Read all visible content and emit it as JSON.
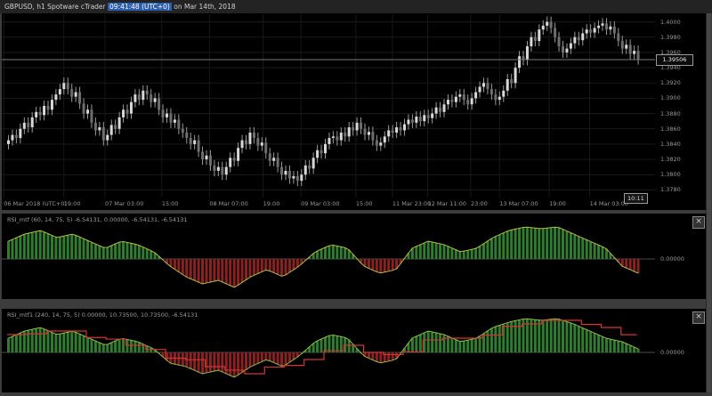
{
  "window": {
    "title_prefix": "GBPUSD, h1 Spotware cTrader ",
    "title_time": "09:41:48 (UTC+0)",
    "title_suffix": " on Mar 14th, 2018"
  },
  "main_chart": {
    "symbol": "GBPUSD",
    "timeframe": "h1",
    "current_price": 1.39506,
    "current_price_label": "1.39506",
    "time_marker": "10:11",
    "price_max": 1.401,
    "price_min": 1.377,
    "price_axis_labels": [
      "1.4000",
      "1.3980",
      "1.3960",
      "1.3940",
      "1.3920",
      "1.3900",
      "1.3880",
      "1.3860",
      "1.3840",
      "1.3820",
      "1.3800",
      "1.3780"
    ],
    "time_axis_labels": [
      {
        "label": "06 Mar 2018 (UTC+0)",
        "pos": 0.003
      },
      {
        "label": "19:00",
        "pos": 0.095
      },
      {
        "label": "07 Mar 03:00",
        "pos": 0.158
      },
      {
        "label": "15:00",
        "pos": 0.245
      },
      {
        "label": "08 Mar 07:00",
        "pos": 0.318
      },
      {
        "label": "19:00",
        "pos": 0.4
      },
      {
        "label": "09 Mar 03:00",
        "pos": 0.458
      },
      {
        "label": "15:00",
        "pos": 0.542
      },
      {
        "label": "11 Mar 23:00",
        "pos": 0.598
      },
      {
        "label": "12 Mar 11:00",
        "pos": 0.652
      },
      {
        "label": "23:00",
        "pos": 0.718
      },
      {
        "label": "13 Mar 07:00",
        "pos": 0.762
      },
      {
        "label": "19:00",
        "pos": 0.838
      },
      {
        "label": "14 Mar 03:00",
        "pos": 0.9
      }
    ],
    "first_open": 1.384,
    "candle_closes": [
      1.3845,
      1.3852,
      1.3848,
      1.386,
      1.3868,
      1.3862,
      1.3875,
      1.3882,
      1.3878,
      1.389,
      1.3885,
      1.3898,
      1.3905,
      1.3912,
      1.392,
      1.3912,
      1.3902,
      1.3908,
      1.3893,
      1.388,
      1.3885,
      1.3868,
      1.3858,
      1.3862,
      1.3845,
      1.3852,
      1.3865,
      1.386,
      1.3875,
      1.3885,
      1.388,
      1.3895,
      1.3905,
      1.3898,
      1.391,
      1.3905,
      1.3895,
      1.39,
      1.3885,
      1.3875,
      1.388,
      1.3868,
      1.3872,
      1.386,
      1.3855,
      1.3848,
      1.384,
      1.3845,
      1.383,
      1.382,
      1.3825,
      1.3812,
      1.3805,
      1.381,
      1.38,
      1.381,
      1.3822,
      1.3818,
      1.3835,
      1.3845,
      1.384,
      1.3855,
      1.3848,
      1.3838,
      1.3842,
      1.3828,
      1.3818,
      1.3822,
      1.381,
      1.38,
      1.3805,
      1.3795,
      1.3798,
      1.3792,
      1.38,
      1.3812,
      1.3808,
      1.3822,
      1.3832,
      1.3828,
      1.384,
      1.3848,
      1.385,
      1.3845,
      1.3855,
      1.385,
      1.3862,
      1.3858,
      1.3868,
      1.386,
      1.3852,
      1.3856,
      1.3845,
      1.3838,
      1.3842,
      1.385,
      1.3858,
      1.3855,
      1.3862,
      1.3858,
      1.3866,
      1.3872,
      1.3868,
      1.3876,
      1.387,
      1.3878,
      1.3874,
      1.388,
      1.3888,
      1.3882,
      1.3892,
      1.3898,
      1.3895,
      1.3902,
      1.3905,
      1.3898,
      1.3892,
      1.39,
      1.3908,
      1.3915,
      1.392,
      1.3912,
      1.3905,
      1.3898,
      1.3902,
      1.391,
      1.3925,
      1.392,
      1.394,
      1.3955,
      1.395,
      1.3968,
      1.398,
      1.3975,
      1.399,
      1.3995,
      1.4,
      1.3992,
      1.398,
      1.3968,
      1.396,
      1.3965,
      1.3972,
      1.398,
      1.3976,
      1.3985,
      1.399,
      1.3986,
      1.3992,
      1.3995,
      1.3998,
      1.399,
      1.3994,
      1.3985,
      1.3975,
      1.3965,
      1.397,
      1.3958,
      1.3962,
      1.3951
    ]
  },
  "panels": [
    {
      "header": "RSI_mtf (60, 14, 75, 5) -6.54131, 0.00000, -6.54131, -6.54131",
      "axis_label": "0.00000",
      "close_label": "×",
      "bars": [
        0.5,
        0.7,
        0.8,
        0.6,
        0.7,
        0.5,
        0.3,
        0.5,
        0.4,
        0.2,
        -0.2,
        -0.5,
        -0.7,
        -0.6,
        -0.8,
        -0.5,
        -0.3,
        -0.5,
        -0.2,
        0.2,
        0.4,
        0.3,
        -0.2,
        -0.4,
        -0.3,
        0.3,
        0.5,
        0.4,
        0.2,
        0.3,
        0.6,
        0.8,
        0.9,
        0.85,
        0.9,
        0.7,
        0.5,
        0.3,
        -0.2,
        -0.4
      ]
    },
    {
      "header": "RSI_mtf1 (240, 14, 75, 5) 0.00000, 10.73500, 10.73500, -6.54131",
      "axis_label": "0.00000",
      "close_label": "×",
      "bars": [
        0.4,
        0.6,
        0.7,
        0.5,
        0.6,
        0.4,
        0.2,
        0.4,
        0.3,
        0.1,
        -0.3,
        -0.4,
        -0.6,
        -0.5,
        -0.7,
        -0.4,
        -0.2,
        -0.4,
        -0.1,
        0.3,
        0.5,
        0.4,
        -0.1,
        -0.3,
        -0.2,
        0.4,
        0.6,
        0.5,
        0.3,
        0.4,
        0.7,
        0.85,
        0.95,
        0.9,
        0.95,
        0.8,
        0.6,
        0.4,
        0.3,
        0.1
      ],
      "red_line": [
        0.5,
        0.5,
        0.6,
        0.6,
        0.6,
        0.4,
        0.4,
        0.2,
        0.2,
        0.0,
        -0.2,
        -0.2,
        -0.4,
        -0.4,
        -0.6,
        -0.6,
        -0.4,
        -0.4,
        -0.2,
        -0.2,
        0.2,
        0.2,
        0.0,
        0.0,
        -0.2,
        0.2,
        0.4,
        0.4,
        0.4,
        0.4,
        0.6,
        0.8,
        0.8,
        0.9,
        0.9,
        0.9,
        0.7,
        0.7,
        0.5,
        0.3
      ]
    }
  ],
  "colors": {
    "up_candle": "#d8d8d8",
    "down_candle": "#6e6e6e",
    "wick": "#9a9a9a",
    "pos_bar": "#2f7d2f",
    "neg_bar": "#8b2222",
    "line1": "#b7bd3c",
    "line2_green": "#8fbf3f",
    "line2_red": "#d93232",
    "price_line": "#7a7a7a",
    "title_highlight": "#2b5fad"
  }
}
